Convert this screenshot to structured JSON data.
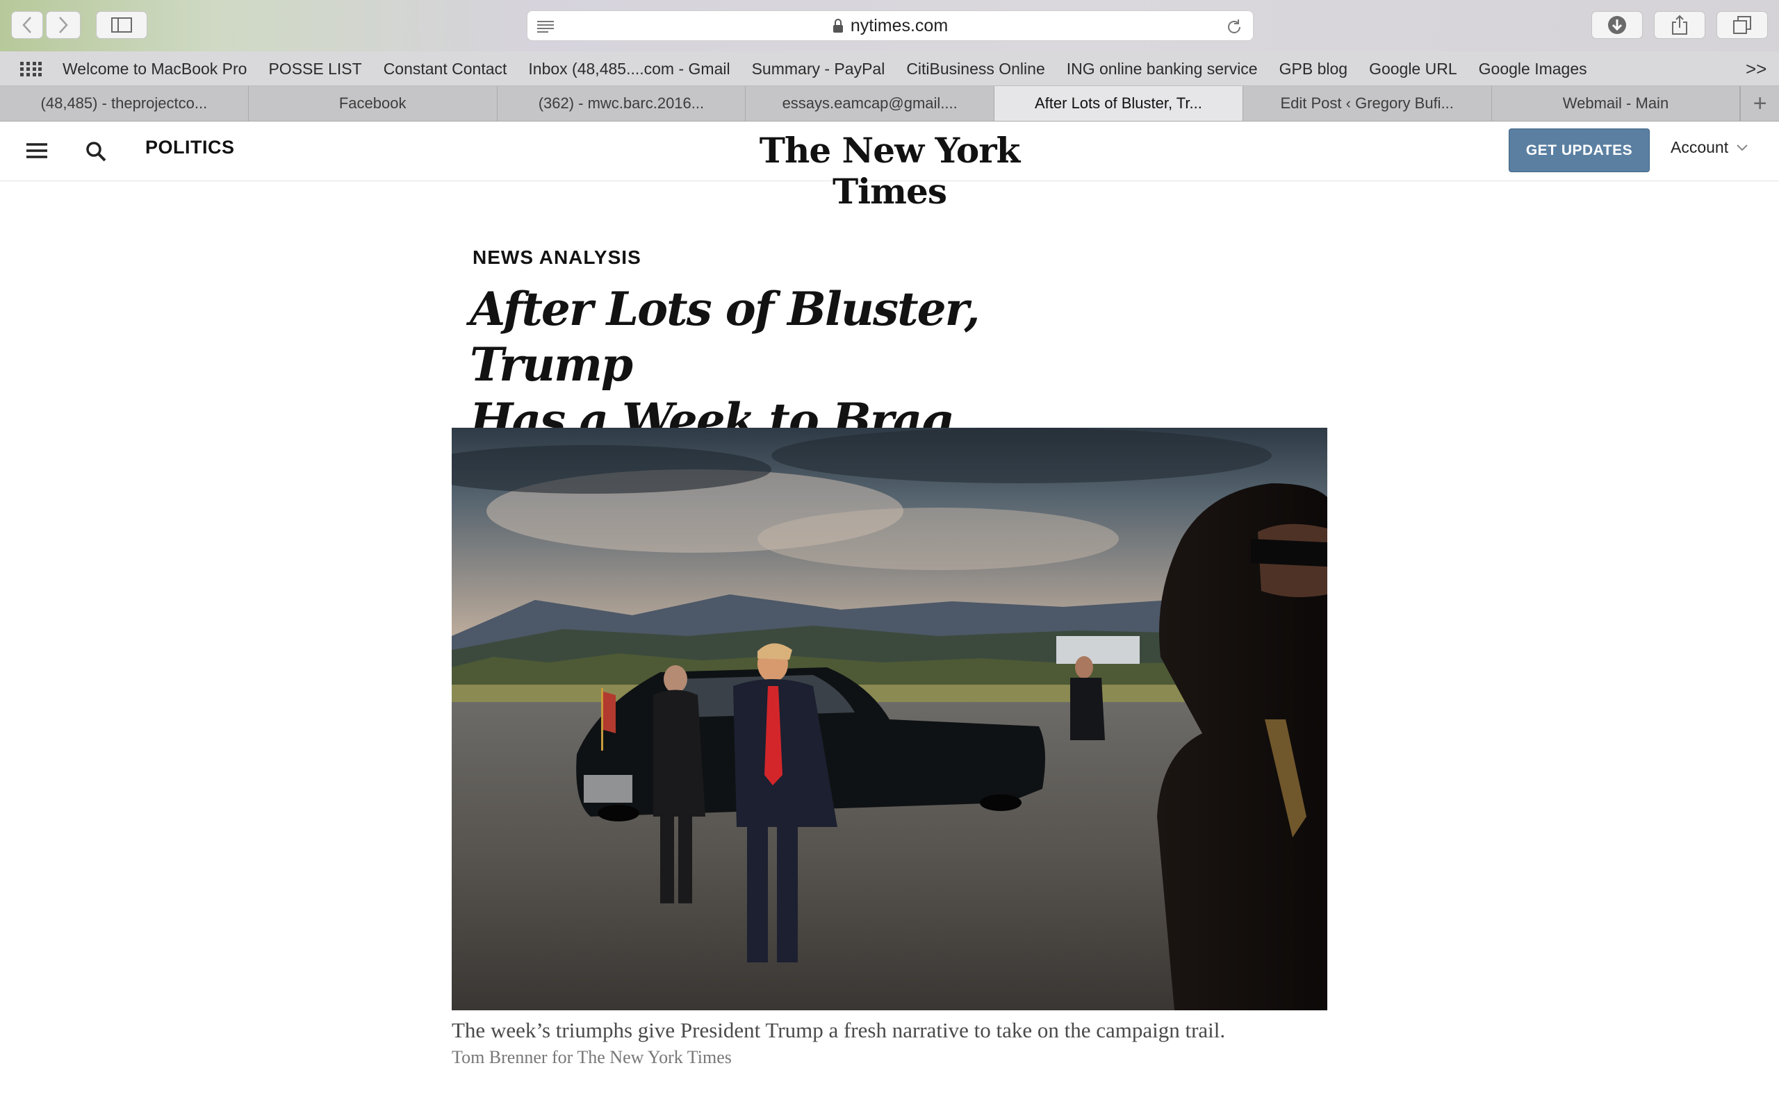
{
  "browser": {
    "url": "nytimes.com",
    "bookmarks": [
      "Welcome to MacBook Pro",
      "POSSE LIST",
      "Constant Contact",
      "Inbox (48,485....com - Gmail",
      "Summary - PayPal",
      "CitiBusiness Online",
      "ING online banking service",
      "GPB blog",
      "Google URL",
      "Google Images"
    ],
    "bookmarks_overflow": ">>",
    "tabs": [
      {
        "label": "(48,485) - theprojectco..."
      },
      {
        "label": "Facebook"
      },
      {
        "label": "(362) - mwc.barc.2016..."
      },
      {
        "label": "essays.eamcap@gmail...."
      },
      {
        "label": "After Lots of Bluster, Tr...",
        "active": true
      },
      {
        "label": "Edit Post ‹ Gregory Bufi..."
      },
      {
        "label": "Webmail - Main"
      }
    ],
    "new_tab": "+"
  },
  "header": {
    "section": "POLITICS",
    "logo": "The New York Times",
    "get_updates": "GET UPDATES",
    "account": "Account"
  },
  "article": {
    "kicker": "NEWS ANALYSIS",
    "headline_line1": "After Lots of Bluster, Trump",
    "headline_line2": "Has a Week to Brag About",
    "caption": "The week’s triumphs give President Trump a fresh narrative to take on the campaign trail.",
    "credit": "Tom Brenner for The New York Times"
  },
  "colors": {
    "button": "#5a7fa1",
    "text": "#121212"
  }
}
